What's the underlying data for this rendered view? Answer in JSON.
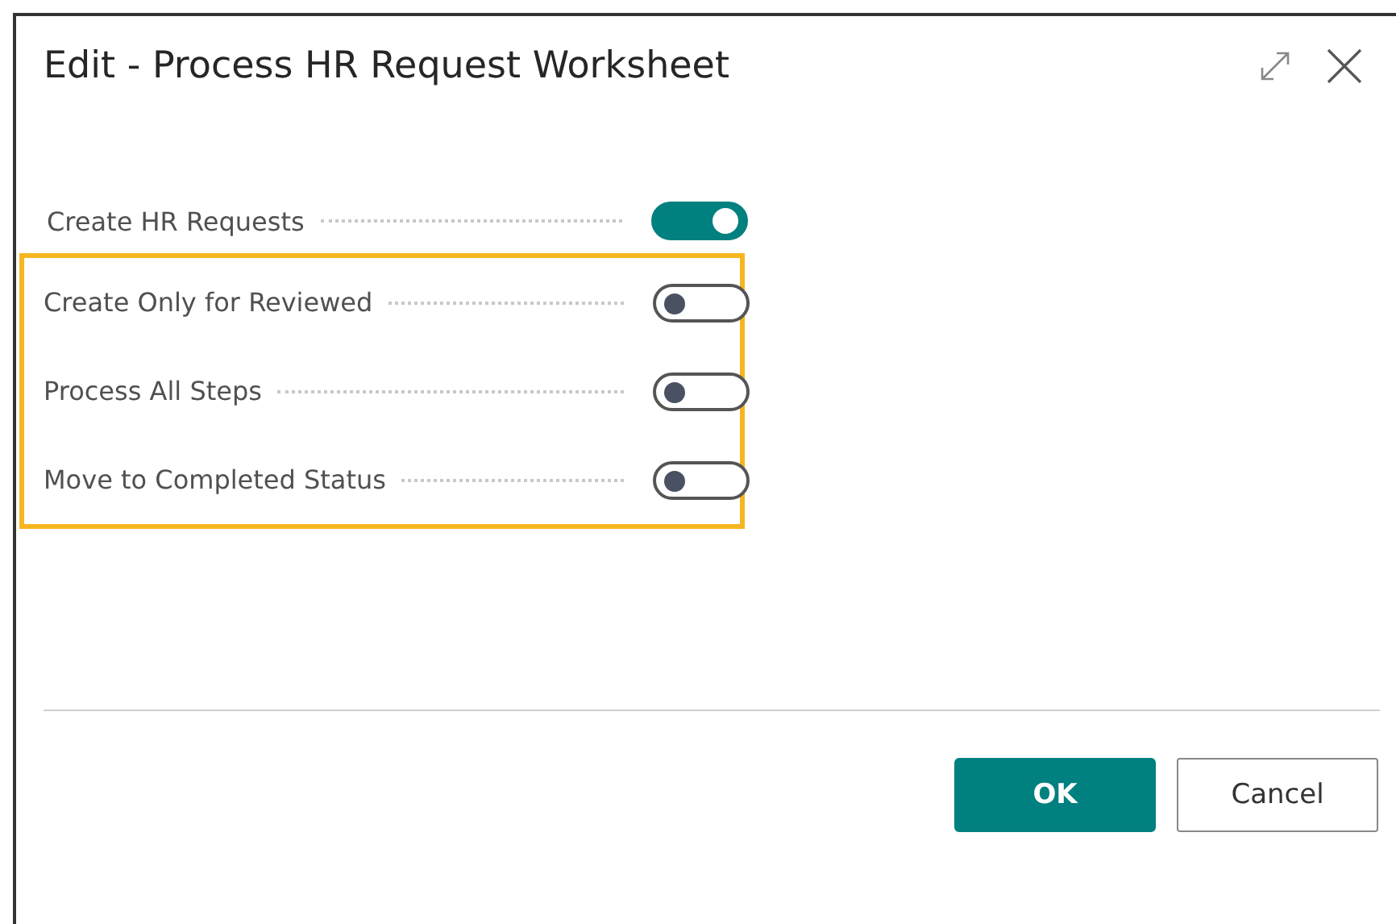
{
  "window": {
    "title": "Edit - Process HR Request Worksheet"
  },
  "fields": [
    {
      "label": "Create HR Requests",
      "on": true,
      "highlighted": false
    },
    {
      "label": "Create Only for Reviewed",
      "on": false,
      "highlighted": true
    },
    {
      "label": "Process All Steps",
      "on": false,
      "highlighted": true
    },
    {
      "label": "Move to Completed Status",
      "on": false,
      "highlighted": true
    }
  ],
  "buttons": [
    {
      "label": "OK",
      "kind": "primary"
    },
    {
      "label": "Cancel",
      "kind": "secondary"
    }
  ]
}
